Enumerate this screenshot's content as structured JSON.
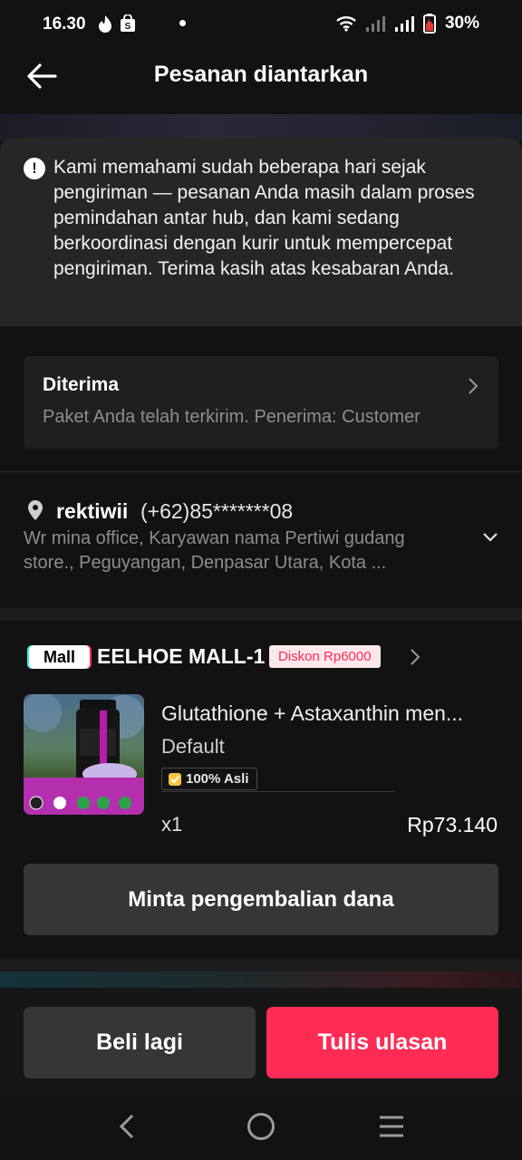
{
  "status_bar": {
    "time": "16.30",
    "battery": "30%",
    "icons": [
      "tiktok-icon",
      "shopee-icon",
      "wifi-icon",
      "signal-icon",
      "signal-icon",
      "battery-icon"
    ]
  },
  "header": {
    "title": "Pesanan diantarkan",
    "back_icon": "arrow-left-icon"
  },
  "notice": {
    "icon": "exclamation-icon",
    "text": "Kami memahami sudah beberapa hari sejak pengiriman — pesanan Anda masih dalam proses pemindahan antar hub, dan kami sedang berkoordinasi dengan kurir untuk mempercepat pengiriman. Terima kasih atas kesabaran Anda."
  },
  "delivery_status": {
    "title": "Diterima",
    "subtitle": "Paket Anda telah terkirim. Penerima: Customer"
  },
  "address": {
    "name": "rektiwii",
    "phone": "(+62)85*******08",
    "line1": "Wr mina office, Karyawan nama Pertiwi gudang",
    "line2": "store., Peguyangan, Denpasar Utara, Kota ..."
  },
  "shop": {
    "badge": "Mall",
    "name": "EELHOE MALL-1",
    "discount": "Diskon Rp6000"
  },
  "product": {
    "name": "Glutathione + Astaxanthin men...",
    "variant": "Default",
    "authentic_badge": "100% Asli",
    "quantity": "x1",
    "price": "Rp73.140"
  },
  "buttons": {
    "refund": "Minta pengembalian dana",
    "buy_again": "Beli lagi",
    "review": "Tulis ulasan"
  },
  "colors": {
    "accent": "#fe2c55",
    "background": "#121212",
    "card": "#1f1f1f",
    "button_dark": "#363636"
  }
}
